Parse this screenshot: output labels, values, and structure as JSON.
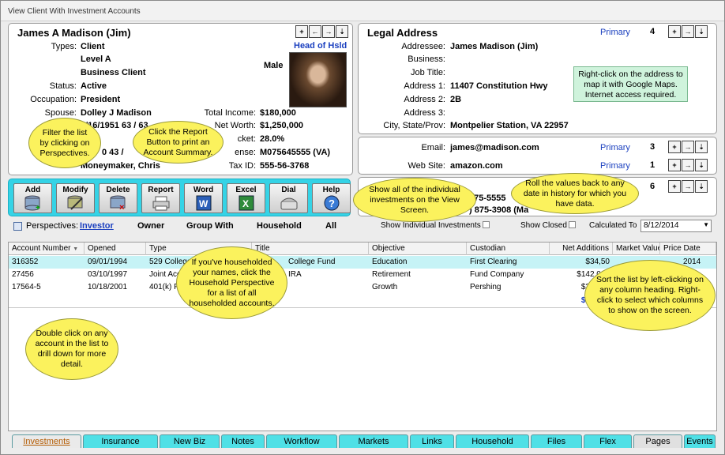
{
  "window": {
    "title": "View Client With Investment Accounts"
  },
  "client": {
    "name": "James A Madison (Jim)",
    "types_label": "Types:",
    "types": [
      "Client",
      "Level A",
      "Business Client"
    ],
    "gender": "Male",
    "head_label": "Head of Hsld",
    "status_label": "Status:",
    "status": "Active",
    "occupation_label": "Occupation:",
    "occupation": "President",
    "spouse_label": "Spouse:",
    "spouse": "Dolley J Madison",
    "birth_partial": "8/16/1951   63 / 63",
    "row3_partial": "0   43 /",
    "producer_partial": "Moneymaker, Chris",
    "income_label": "Total Income:",
    "income": "$180,000",
    "networth_label": "Net Worth:",
    "networth": "$1,250,000",
    "bracket_label": "cket:",
    "bracket": "28.0%",
    "license_label": "ense:",
    "license": "M075645555 (VA)",
    "taxid_label": "Tax ID:",
    "taxid": "555-56-3768"
  },
  "address": {
    "title": "Legal Address",
    "primary": "Primary",
    "count": "4",
    "addressee_label": "Addressee:",
    "addressee": "James Madison (Jim)",
    "business_label": "Business:",
    "jobtitle_label": "Job Title:",
    "addr1_label": "Address 1:",
    "addr1": "11407 Constitution Hwy",
    "addr2_label": "Address 2:",
    "addr2": "2B",
    "addr3_label": "Address 3:",
    "city_label": "City, State/Prov:",
    "city": "Montpelier Station,   VA   22957",
    "note": "Right-click on the address to map it with Google Maps. Internet access required."
  },
  "contact": {
    "email_label": "Email:",
    "email": "james@madison.com",
    "email_primary": "Primary",
    "email_count": "3",
    "web_label": "Web Site:",
    "web": "amazon.com",
    "web_primary": "Primary",
    "web_count": "1",
    "phone_count": "6",
    "phone1": "875-5555",
    "phone2": ") 875-3908  (Ma"
  },
  "toolbar": {
    "add": "Add",
    "modify": "Modify",
    "delete": "Delete",
    "report": "Report",
    "word": "Word",
    "excel": "Excel",
    "dial": "Dial",
    "help": "Help"
  },
  "perspectives": {
    "label": "Perspectives:",
    "items": [
      "Investor",
      "Owner",
      "Group With",
      "Household",
      "All"
    ],
    "show_individual": "Show Individual Investments",
    "show_closed": "Show Closed",
    "calculated_to": "Calculated To",
    "date": "8/12/2014"
  },
  "grid": {
    "columns": [
      "Account Number",
      "Opened",
      "Type",
      "Title",
      "Objective",
      "Custodian",
      "Net Additions",
      "Market Value",
      "Price Date"
    ],
    "rows": [
      {
        "account": "316352",
        "opened": "09/01/1994",
        "type": "529 College S",
        "title": "College Fund",
        "objective": "Education",
        "custodian": "First Clearing",
        "net": "$34,50",
        "price_date": "2014"
      },
      {
        "account": "27456",
        "opened": "03/10/1997",
        "type": "Joint Acco",
        "title": "IRA",
        "objective": "Retirement",
        "custodian": "Fund Company",
        "net": "$142,000",
        "price_date": ""
      },
      {
        "account": "17564-5",
        "opened": "10/18/2001",
        "type": "401(k) F",
        "title": "",
        "objective": "Growth",
        "custodian": "Pershing",
        "net": "$354,65",
        "price_date": ""
      }
    ],
    "total": "$531,15"
  },
  "bubbles": {
    "filter": "Filter the list by clicking on Perspectives.",
    "report": "Click the Report Button to print an Account Summary.",
    "individual": "Show all of the individual investments on the View Screen.",
    "rollback": "Roll the values back to any date in history for which you have data.",
    "household": "If you've householded your names, click the Household Perspective for a list of all householded accounts.",
    "drill": "Double click on any account in the list to drill down for more detail.",
    "sort": "Sort the list by left-clicking on any column heading. Right-click to select which columns to show on the screen."
  },
  "tabs": [
    "Investments",
    "Insurance",
    "New Biz",
    "Notes",
    "Workflow",
    "Markets",
    "Links",
    "Household",
    "Files",
    "Flex",
    "Pages",
    "Events"
  ]
}
